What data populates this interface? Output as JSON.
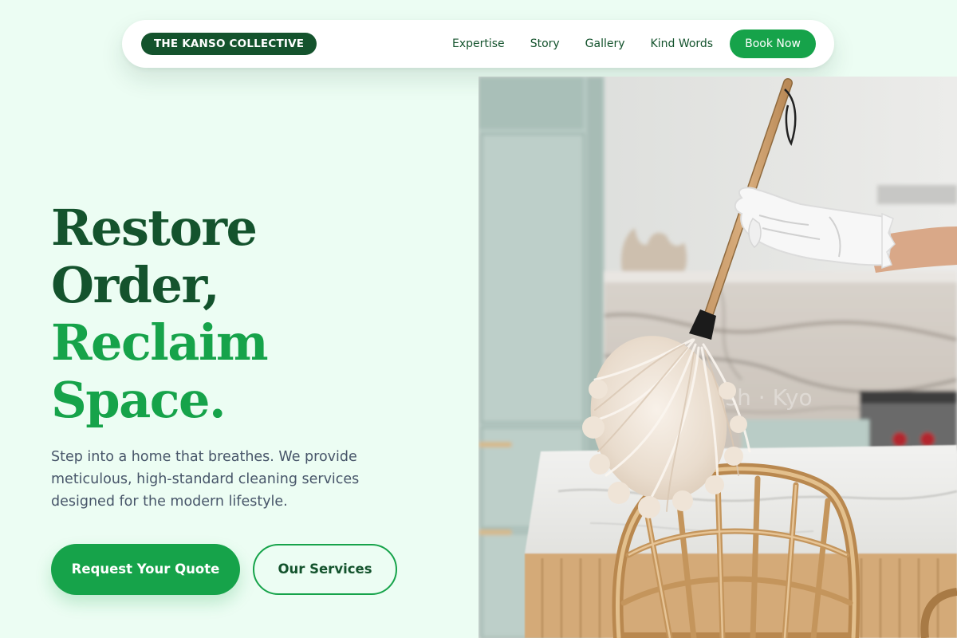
{
  "nav": {
    "brand": "THE KANSO COLLECTIVE",
    "links": [
      "Expertise",
      "Story",
      "Gallery",
      "Kind Words"
    ],
    "cta": "Book Now"
  },
  "hero": {
    "headline": {
      "line1": "Restore",
      "line2": "Order,",
      "line3": "Reclaim",
      "line4": "Space."
    },
    "subtext": "Step into a home that breathes. We provide meticulous, high-standard cleaning services designed for the modern lifestyle.",
    "primary_cta": "Request Your Quote",
    "secondary_cta": "Our Services",
    "image_watermark": "Unsplash · Kyo"
  },
  "colors": {
    "background": "#ecfdf3",
    "brand_dark": "#14532d",
    "accent": "#16a34a",
    "body_text": "#475569",
    "surface": "#ffffff"
  },
  "icons": {
    "hero_image": "feather-duster-photo"
  }
}
